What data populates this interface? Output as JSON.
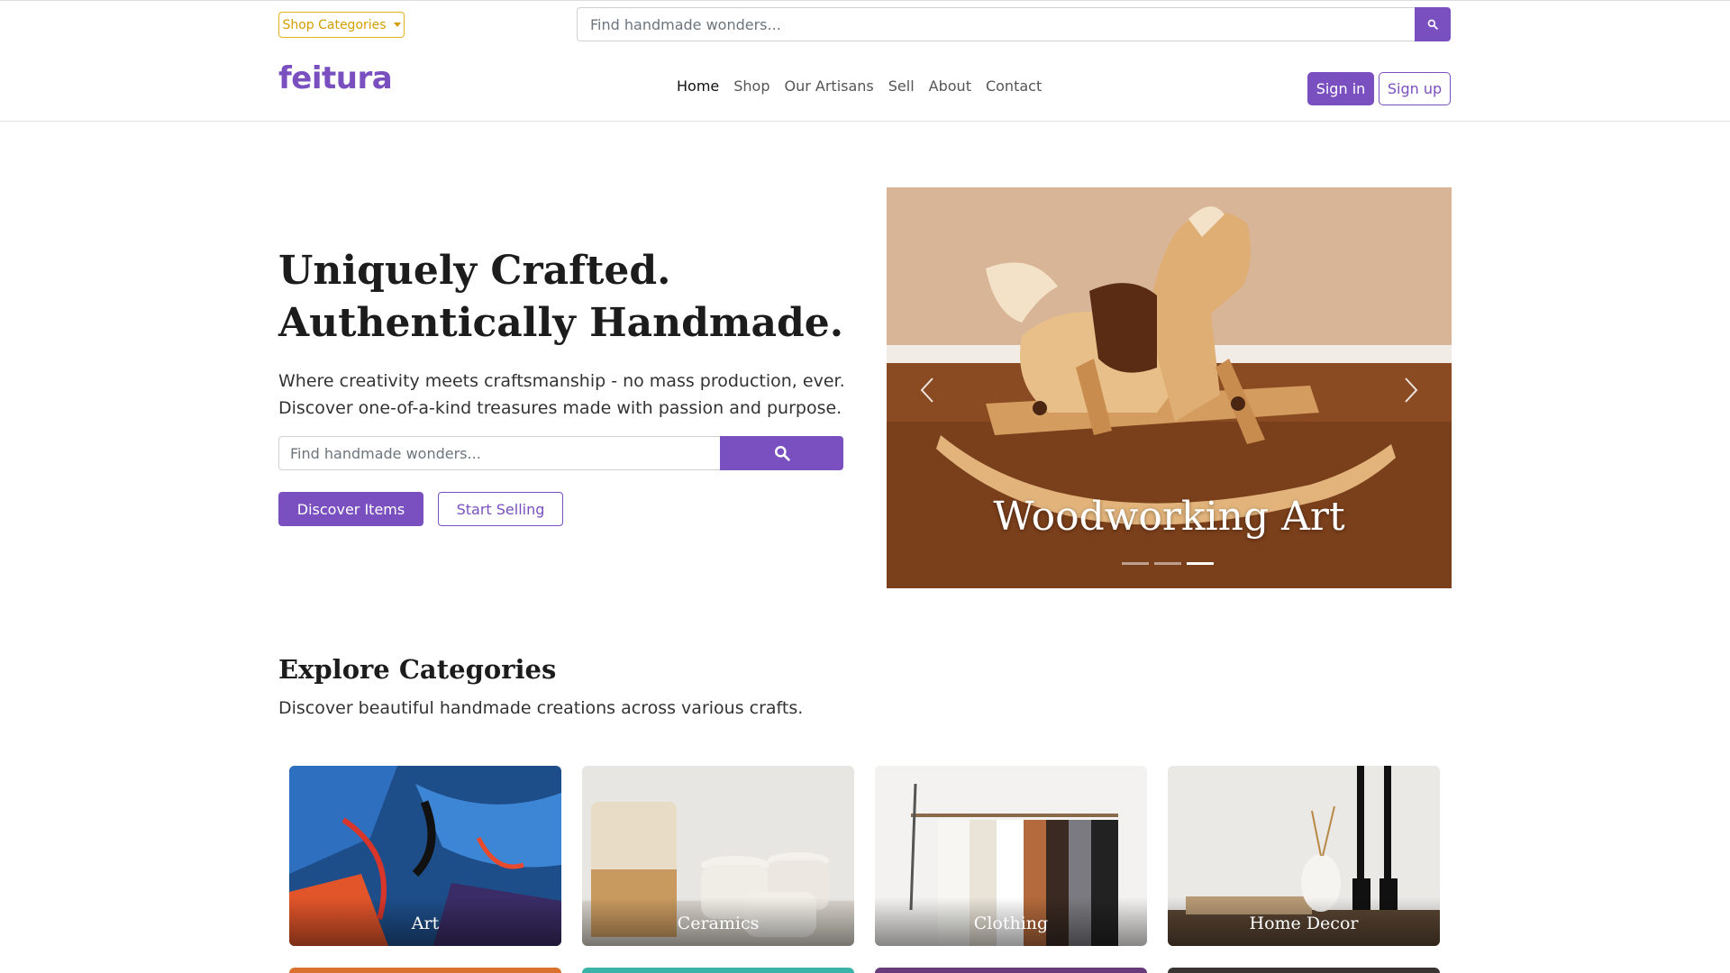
{
  "header": {
    "shop_categories": "Shop Categories",
    "search_placeholder": "Find handmade wonders...",
    "logo": "feitura",
    "nav": [
      "Home",
      "Shop",
      "Our Artisans",
      "Sell",
      "About",
      "Contact"
    ],
    "active_nav": "Home",
    "signin": "Sign in",
    "signup": "Sign up"
  },
  "hero": {
    "title": "Uniquely Crafted. Authentically Handmade.",
    "subtitle_lines": [
      "Where creativity meets craftsmanship - no mass production, ever.",
      "Discover one-of-a-kind treasures made with passion and purpose."
    ],
    "search_placeholder": "Find handmade wonders...",
    "discover_button": "Discover Items",
    "selling_button": "Start Selling"
  },
  "carousel": {
    "caption": "Woodworking Art",
    "slide_count": 3,
    "active_slide": 3
  },
  "categories": {
    "title": "Explore Categories",
    "subtitle": "Discover beautiful handmade creations across various crafts.",
    "items": [
      "Art",
      "Ceramics",
      "Clothing",
      "Home Decor"
    ]
  },
  "colors": {
    "brand": "#7a50c0",
    "accent_yellow": "#e0b21b"
  }
}
